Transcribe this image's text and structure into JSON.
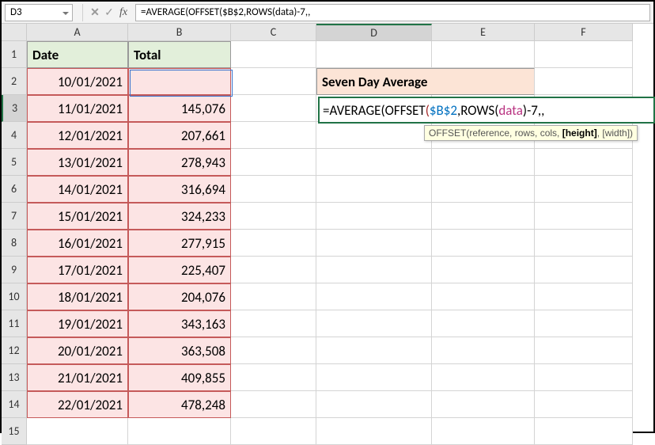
{
  "formula_bar": {
    "cell_ref": "D3",
    "formula_text": "=AVERAGE(OFFSET($B$2,ROWS(data)-7,,",
    "cancel_glyph": "✕",
    "enter_glyph": "✓",
    "fx_glyph": "fx"
  },
  "columns": [
    "A",
    "B",
    "C",
    "D",
    "E",
    "F"
  ],
  "rows": [
    "1",
    "2",
    "3",
    "4",
    "5",
    "6",
    "7",
    "8",
    "9",
    "10",
    "11",
    "12",
    "13",
    "14",
    "15"
  ],
  "headers": {
    "A1": "Date",
    "B1": "Total",
    "D2": "Seven Day Average"
  },
  "data": [
    {
      "date": "10/01/2021",
      "total": ""
    },
    {
      "date": "11/01/2021",
      "total": "145,076"
    },
    {
      "date": "12/01/2021",
      "total": "207,661"
    },
    {
      "date": "13/01/2021",
      "total": "278,943"
    },
    {
      "date": "14/01/2021",
      "total": "316,694"
    },
    {
      "date": "15/01/2021",
      "total": "324,233"
    },
    {
      "date": "16/01/2021",
      "total": "277,915"
    },
    {
      "date": "17/01/2021",
      "total": "225,407"
    },
    {
      "date": "18/01/2021",
      "total": "204,076"
    },
    {
      "date": "19/01/2021",
      "total": "343,163"
    },
    {
      "date": "20/01/2021",
      "total": "363,508"
    },
    {
      "date": "21/01/2021",
      "total": "409,855"
    },
    {
      "date": "22/01/2021",
      "total": "478,248"
    }
  ],
  "formula_display": {
    "prefix": "=AVERAGE",
    "p1": "(",
    "offset": "OFFSET",
    "p2": "(",
    "ref": "$B$2",
    "c1": ",",
    "rowsfn": "ROWS",
    "p3": "(",
    "rng": "data",
    "p4": ")",
    "suffix": "-7,,"
  },
  "tooltip": {
    "fn": "OFFSET(",
    "args": "reference, rows, cols, ",
    "bold": "[height]",
    "rest": ", [width])"
  }
}
